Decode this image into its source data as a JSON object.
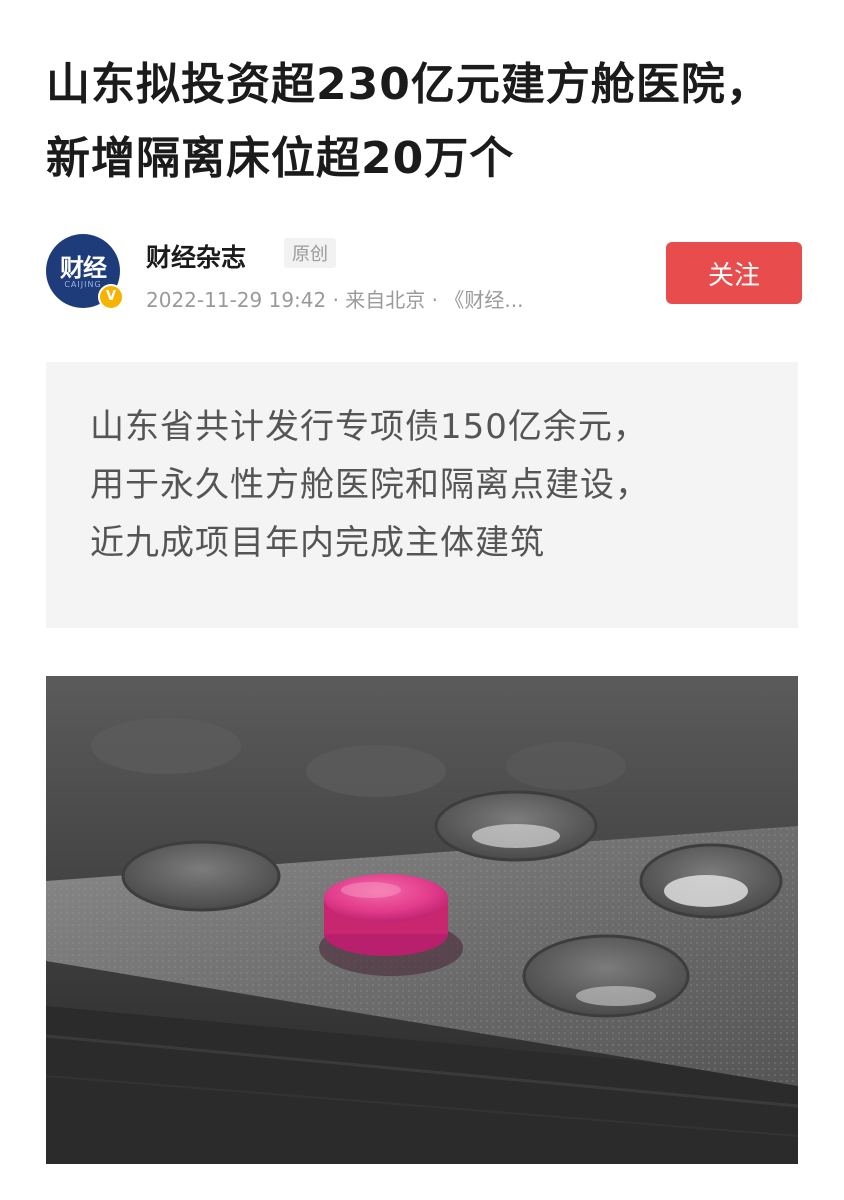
{
  "article": {
    "headline": "山东拟投资超230亿元建方舱医院，新增隔离床位超20万个"
  },
  "author": {
    "avatar_text": "财经",
    "avatar_sub": "CAIJING",
    "verified_mark": "V",
    "name": "财经杂志",
    "original_tag": "原创",
    "meta": "2022-11-29 19:42 · 来自北京 · 《财经...",
    "follow_label": "关注"
  },
  "summary": {
    "lines": [
      "山东省共计发行专项债150亿余元，",
      "用于永久性方舱医院和隔离点建设，",
      "近九成项目年内完成主体建筑"
    ]
  },
  "image": {
    "subject": "pink-pill-blister-pack"
  },
  "colors": {
    "follow_button": "#e94c4c",
    "summary_bg": "#f4f4f5",
    "pill": "#e23b8c"
  }
}
